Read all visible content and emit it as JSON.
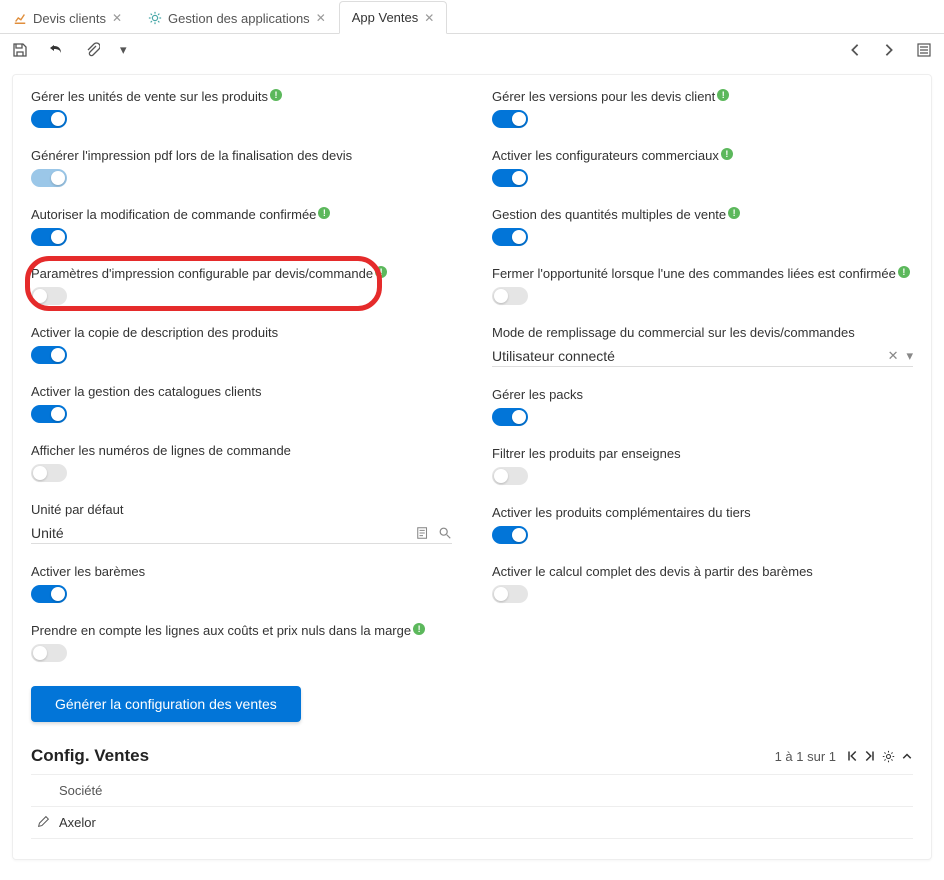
{
  "tabs": [
    {
      "label": "Devis clients",
      "icon": "chart"
    },
    {
      "label": "Gestion des applications",
      "icon": "gear"
    },
    {
      "label": "App Ventes",
      "icon": null,
      "active": true
    }
  ],
  "left_column": [
    {
      "id": "manage_sale_units",
      "label": "Gérer les unités de vente sur les produits",
      "help": true,
      "state": "on"
    },
    {
      "id": "generate_pdf",
      "label": "Générer l'impression pdf lors de la finalisation des devis",
      "help": false,
      "state": "locked-on"
    },
    {
      "id": "allow_modify_order",
      "label": "Autoriser la modification de commande confirmée",
      "help": true,
      "state": "on"
    },
    {
      "id": "print_params",
      "label": "Paramètres d'impression configurable par devis/commande",
      "help": true,
      "state": "off",
      "highlight": true
    },
    {
      "id": "copy_desc",
      "label": "Activer la copie de description des produits",
      "help": false,
      "state": "on"
    },
    {
      "id": "catalogue_manage",
      "label": "Activer la gestion des catalogues clients",
      "help": false,
      "state": "on"
    },
    {
      "id": "show_line_numbers",
      "label": "Afficher les numéros de lignes de commande",
      "help": false,
      "state": "off"
    },
    {
      "id": "default_unit",
      "label": "Unité par défaut",
      "type": "lookup",
      "value": "Unité"
    },
    {
      "id": "enable_baremes",
      "label": "Activer les barèmes",
      "help": false,
      "state": "on"
    },
    {
      "id": "zero_cost_margin",
      "label": "Prendre en compte les lignes aux coûts et prix nuls dans la marge",
      "help": true,
      "state": "off"
    }
  ],
  "right_column": [
    {
      "id": "quote_versions",
      "label": "Gérer les versions pour les devis client",
      "help": true,
      "state": "on"
    },
    {
      "id": "enable_configs",
      "label": "Activer les configurateurs commerciaux",
      "help": true,
      "state": "on"
    },
    {
      "id": "multi_qty",
      "label": "Gestion des quantités multiples de vente",
      "help": true,
      "state": "on"
    },
    {
      "id": "close_opportunity",
      "label": "Fermer l'opportunité lorsque l'une des commandes liées est confirmée",
      "help": true,
      "state": "off"
    },
    {
      "id": "salesman_fill_mode",
      "label": "Mode de remplissage du commercial sur les devis/commandes",
      "type": "select",
      "value": "Utilisateur connecté"
    },
    {
      "id": "manage_packs",
      "label": "Gérer les packs",
      "help": false,
      "state": "on"
    },
    {
      "id": "filter_brand",
      "label": "Filtrer les produits par enseignes",
      "help": false,
      "state": "off"
    },
    {
      "id": "complementary_prods",
      "label": "Activer les produits complémentaires du tiers",
      "help": false,
      "state": "on"
    },
    {
      "id": "full_calc_baremes",
      "label": "Activer le calcul complet des devis à partir des barèmes",
      "help": false,
      "state": "off"
    }
  ],
  "button": {
    "label": "Générer la configuration des ventes"
  },
  "subpanel": {
    "title": "Config. Ventes",
    "pager_text": "1 à 1 sur 1",
    "column_header": "Société",
    "rows": [
      {
        "societe": "Axelor"
      }
    ]
  }
}
